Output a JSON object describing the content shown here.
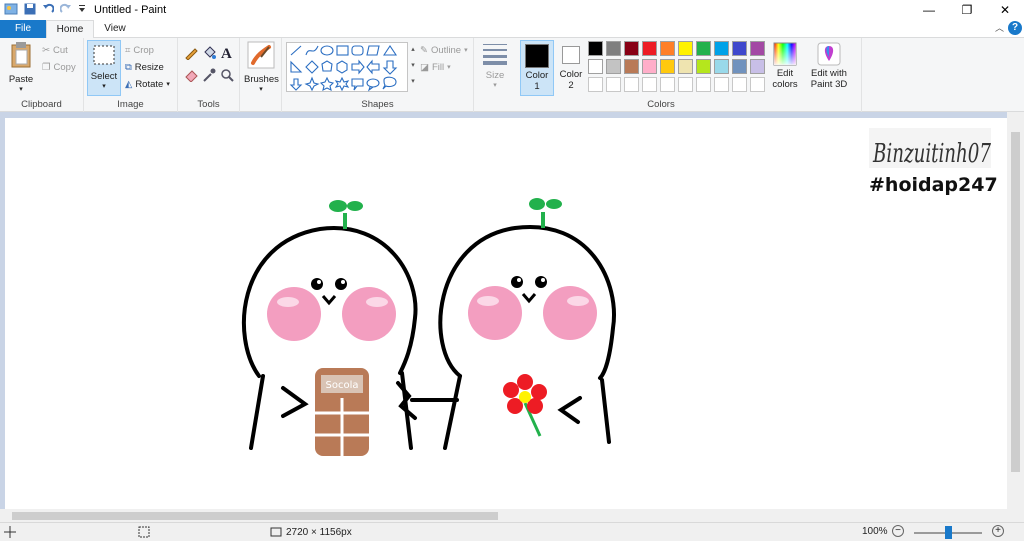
{
  "window": {
    "title": "Untitled - Paint",
    "minimize": "—",
    "restore": "❐",
    "close": "✕"
  },
  "tabs": [
    {
      "label": "File"
    },
    {
      "label": "Home"
    },
    {
      "label": "View"
    }
  ],
  "help": "?",
  "ribbon": {
    "clipboard": {
      "label": "Clipboard",
      "paste": "Paste",
      "cut": "Cut",
      "copy": "Copy"
    },
    "image": {
      "label": "Image",
      "select": "Select",
      "crop": "Crop",
      "resize": "Resize",
      "rotate": "Rotate"
    },
    "tools": {
      "label": "Tools"
    },
    "brushes": {
      "label": "Brushes"
    },
    "shapes": {
      "label": "Shapes",
      "outline": "Outline",
      "fill": "Fill"
    },
    "size": {
      "label": "Size"
    },
    "colors": {
      "label": "Colors",
      "color1": "Color 1",
      "color1_a": "Color",
      "color1_b": "1",
      "color2_a": "Color",
      "color2_b": "2",
      "color1_value": "#000000",
      "color2_value": "#ffffff",
      "edit_a": "Edit",
      "edit_b": "colors",
      "paint3d_a": "Edit with",
      "paint3d_b": "Paint 3D",
      "palette_row1": [
        "#000000",
        "#7f7f7f",
        "#880015",
        "#ed1c24",
        "#ff7f27",
        "#fff200",
        "#22b14c",
        "#00a2e8",
        "#3f48cc",
        "#a349a4"
      ],
      "palette_row2": [
        "#ffffff",
        "#c3c3c3",
        "#b97a57",
        "#ffaec9",
        "#ffc90e",
        "#efe4b0",
        "#b5e61d",
        "#99d9ea",
        "#7092be",
        "#c8bfe7"
      ]
    }
  },
  "canvas": {
    "signature": "Binzuitinh07",
    "hashtag": "#hoidap247",
    "chocolate_label": "Socola"
  },
  "status": {
    "dimensions": "2720 × 1156px",
    "zoom": "100%",
    "zoom_out": "−",
    "zoom_in": "+"
  }
}
